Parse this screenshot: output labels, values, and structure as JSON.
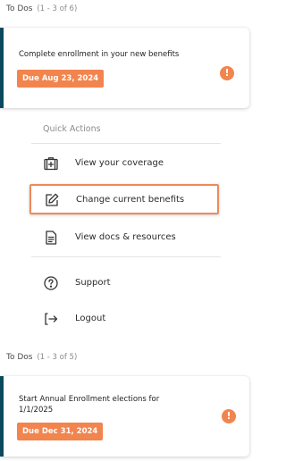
{
  "todos_section_1": {
    "title": "To Dos",
    "count": "(1 - 3 of 6)",
    "task": {
      "title": "Complete enrollment in your new benefits",
      "due": "Due Aug 23, 2024",
      "alert_symbol": "!"
    }
  },
  "quick_actions": {
    "title": "Quick Actions",
    "items": [
      {
        "label": "View your coverage",
        "icon": "medical-bag-icon"
      },
      {
        "label": "Change current benefits",
        "icon": "edit-icon"
      },
      {
        "label": "View docs & resources",
        "icon": "document-icon"
      },
      {
        "label": "Support",
        "icon": "help-circle-icon"
      },
      {
        "label": "Logout",
        "icon": "logout-icon"
      }
    ]
  },
  "todos_section_2": {
    "title": "To Dos",
    "count": "(1 - 3 of 5)",
    "task": {
      "title": "Start Annual Enrollment elections for 1/1/2025",
      "due": "Due Dec 31, 2024",
      "alert_symbol": "!"
    }
  },
  "colors": {
    "accent_orange": "#f2844e",
    "card_stripe": "#0b4a5e",
    "highlight_border": "#ee8a5a"
  }
}
